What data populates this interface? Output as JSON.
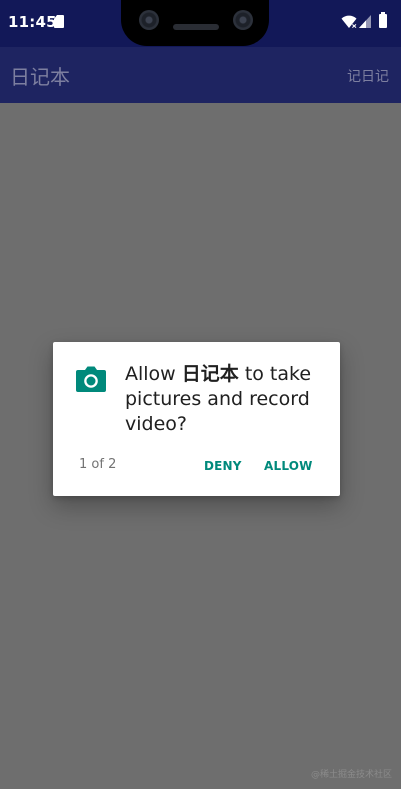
{
  "status_bar": {
    "time": "11:45",
    "icons": [
      "sd-card-icon",
      "wifi-icon",
      "signal-icon",
      "battery-icon"
    ]
  },
  "app_bar": {
    "title": "日记本",
    "action_label": "记日记"
  },
  "permission_dialog": {
    "icon": "camera-icon",
    "message_prefix": "Allow ",
    "app_name": "日记本",
    "message_suffix": " to take pictures and record video?",
    "counter": "1 of 2",
    "deny_label": "DENY",
    "allow_label": "ALLOW",
    "accent_color": "#00897b"
  },
  "watermark": "@稀土掘金技术社区"
}
